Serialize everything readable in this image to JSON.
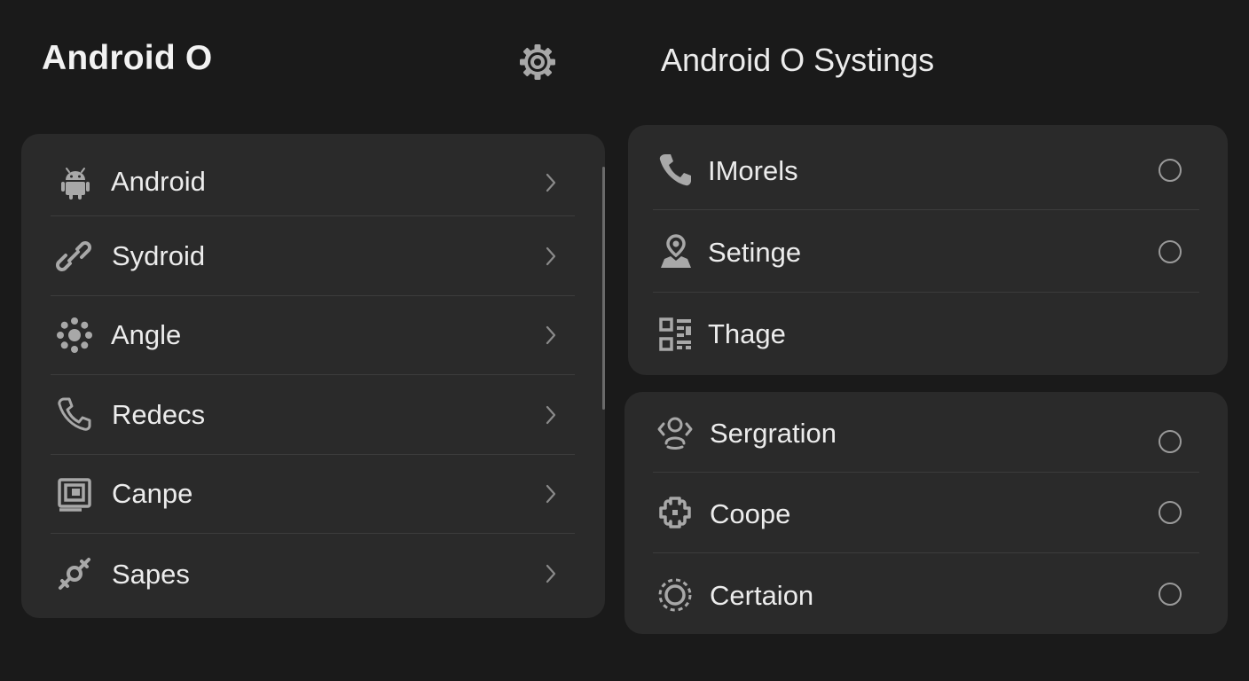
{
  "header": {
    "left_title": "Android O",
    "right_title": "Android O Systings"
  },
  "left_list": {
    "items": [
      {
        "label": "Android",
        "icon": "android-icon"
      },
      {
        "label": "Sydroid",
        "icon": "link-icon"
      },
      {
        "label": "Angle",
        "icon": "dots-ring-icon"
      },
      {
        "label": "Redecs",
        "icon": "phone-icon"
      },
      {
        "label": "Canpe",
        "icon": "picture-frame-icon"
      },
      {
        "label": "Sapes",
        "icon": "plug-icon"
      }
    ]
  },
  "right_group_1": {
    "items": [
      {
        "label": "IMorels",
        "icon": "phone-icon",
        "has_radio": true
      },
      {
        "label": "Setinge",
        "icon": "person-pin-icon",
        "has_radio": true
      },
      {
        "label": "Thage",
        "icon": "qr-grid-icon",
        "has_radio": false
      }
    ]
  },
  "right_group_2": {
    "items": [
      {
        "label": "Sergration",
        "icon": "person-arrows-icon",
        "has_radio": true
      },
      {
        "label": "Coope",
        "icon": "puzzle-icon",
        "has_radio": true
      },
      {
        "label": "Certaion",
        "icon": "sun-dotted-icon",
        "has_radio": true
      }
    ]
  },
  "colors": {
    "background": "#1a1a1a",
    "card": "#2a2a2a",
    "divider": "#3c3c3c",
    "icon": "#a8a8a8",
    "text": "#ececec"
  }
}
